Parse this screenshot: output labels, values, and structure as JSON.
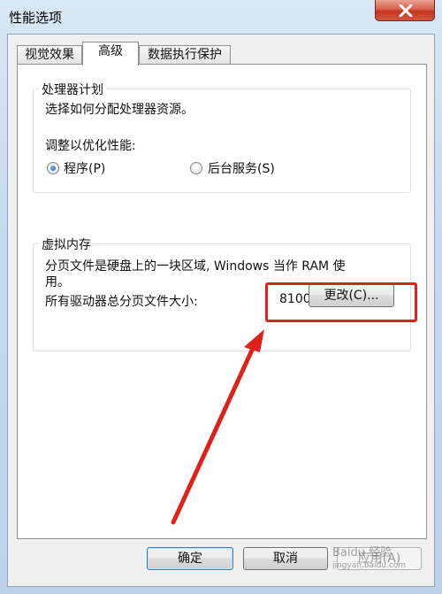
{
  "window": {
    "title": "性能选项"
  },
  "tabs": [
    {
      "label": "视觉效果"
    },
    {
      "label": "高级"
    },
    {
      "label": "数据执行保护"
    }
  ],
  "processor": {
    "title": "处理器计划",
    "description": "选择如何分配处理器资源。",
    "optimize_label": "调整以优化性能:",
    "options": [
      {
        "label": "程序(P)",
        "selected": true
      },
      {
        "label": "后台服务(S)",
        "selected": false
      }
    ]
  },
  "virtual_memory": {
    "title": "虚拟内存",
    "description_line1": "分页文件是硬盘上的一块区域, Windows 当作 RAM 使",
    "description_line2": "用。",
    "total_label": "所有驱动器总分页文件大小:",
    "total_value": "8100 MB",
    "change_button": "更改(C)..."
  },
  "footer": {
    "ok": "确定",
    "cancel": "取消",
    "apply": "应用(A)"
  },
  "watermark": {
    "main": "Baidu 经验",
    "sub": "jingyan.baidu.com"
  },
  "colors": {
    "highlight": "#e0211b",
    "arrow": "#e0211b"
  }
}
